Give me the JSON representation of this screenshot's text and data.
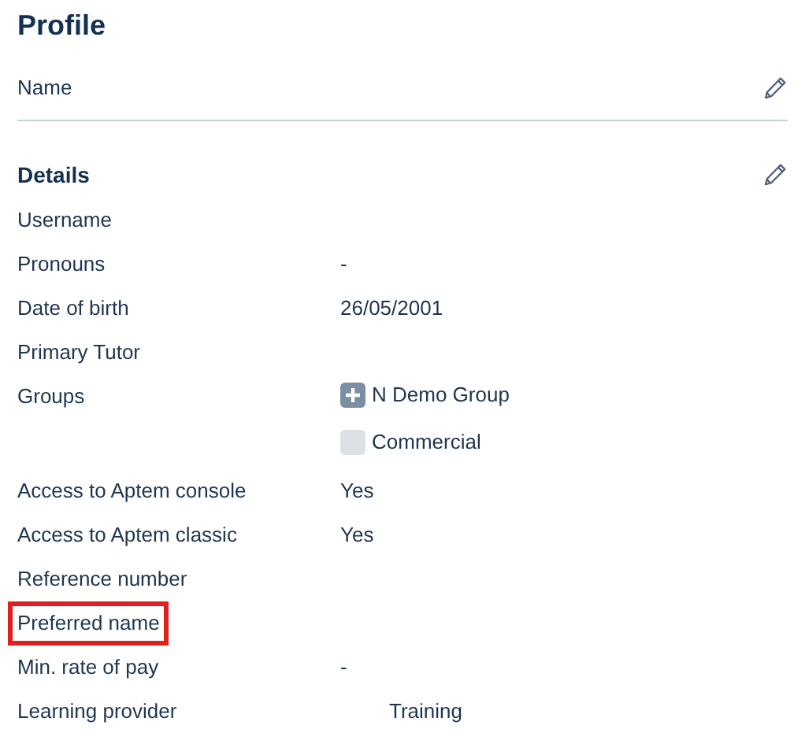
{
  "title": "Profile",
  "name_section": {
    "label": "Name"
  },
  "details": {
    "title": "Details",
    "rows": [
      {
        "label": "Username",
        "highlighted": false
      },
      {
        "label": "Pronouns",
        "value": "-",
        "highlighted": false
      },
      {
        "label": "Date of birth",
        "value": "26/05/2001",
        "highlighted": false
      },
      {
        "label": "Primary Tutor",
        "highlighted": false
      },
      {
        "label": "Groups",
        "highlighted": false,
        "groups": [
          {
            "name": "N Demo Group",
            "kind": "expandable"
          },
          {
            "name": "Commercial",
            "kind": "plain"
          }
        ]
      },
      {
        "label": "Access to Aptem console",
        "value": "Yes",
        "highlighted": false
      },
      {
        "label": "Access to Aptem classic",
        "value": "Yes",
        "highlighted": false
      },
      {
        "label": "Reference number",
        "highlighted": false
      },
      {
        "label": "Preferred name",
        "highlighted": true
      },
      {
        "label": "Min. rate of pay",
        "value": "-",
        "highlighted": false
      },
      {
        "label": "Learning provider",
        "value": "Training",
        "highlighted": false,
        "indented": true
      }
    ]
  }
}
